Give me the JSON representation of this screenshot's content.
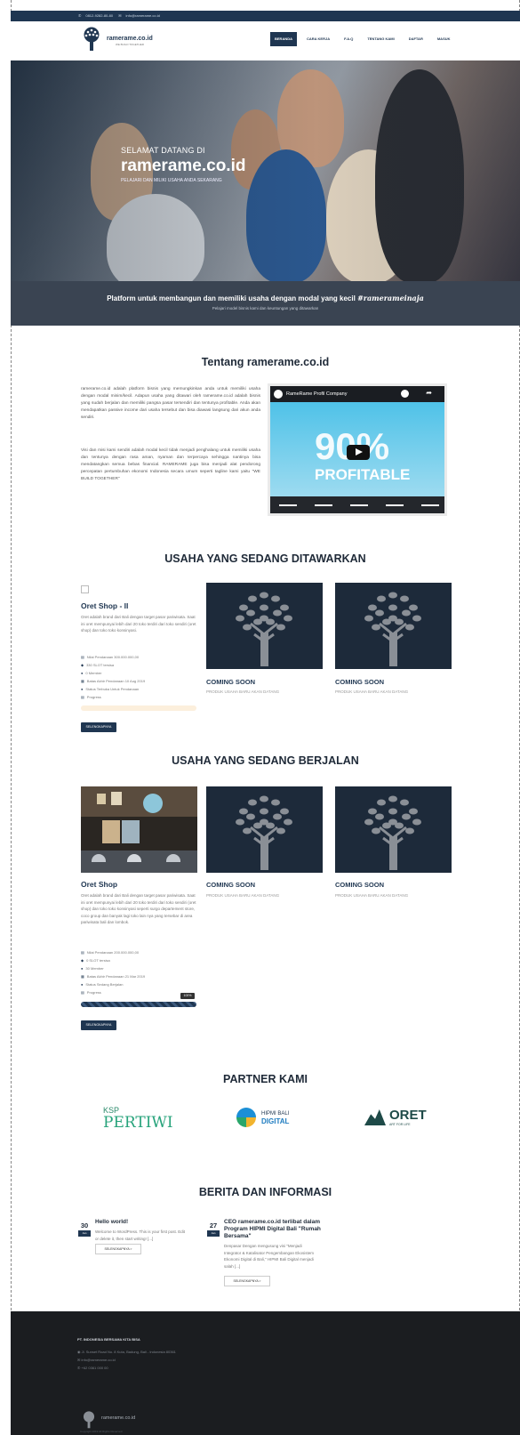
{
  "topbar": {
    "phone": "0812-9282-80-80",
    "email": "info@ramerame.co.id"
  },
  "brand": {
    "name": "ramerame.co.id",
    "tagline": "WE BUILD TOGETHER"
  },
  "nav": [
    "BERANDA",
    "CARA KERJA",
    "F.A.Q",
    "TENTANG KAMI",
    "DAFTAR",
    "MASUK"
  ],
  "hero": {
    "welcome": "SELAMAT DATANG DI",
    "title": "ramerame.co.id",
    "subtitle": "PELAJARI DAN MILIKI USAHA ANDA SEKARANG"
  },
  "strip": {
    "main": "Platform untuk membangun dan memiliki usaha dengan modal yang kecil",
    "hashtag": "#ramerameinaja",
    "sub": "Pelajari model bisnis kami dan keuntungan yang ditawarkan"
  },
  "about": {
    "title": "Tentang ramerame.co.id",
    "p1": "ramerame.co.id adalah platform bisnis yang memungkinkan anda untuk memiliki usaha dengan modal minim/kecil. Adapun usaha yang ditawari oleh ramerame.co.id adalah bisnis yang sudah berjalan dan memiliki pangsa pasar tersendiri dan tentunya profitable. Anda akan mendapatkan passive income dari usaha tersebut dan bisa diawasi langsung dari akun anda sendiri.",
    "p2": "Visi dan misi kami sendiri adalah modal kecil tidak menjadi penghalang untuk memiliki usaha dan tentunya dengan rasa aman, nyaman dan terpercaya sehingga nantinya bisa mendatangkan semua bebas financial. RAMERAME juga bisa menjadi alat pendorong percepatan pertumbuhan ekonomi Indonesia secara umum seperti tagline kami yaitu \"WE BUILD TOGETHER\"",
    "video_title": "RameRame Profil Company",
    "video_big": "90%",
    "video_small": "PROFITABLE"
  },
  "offered": {
    "title": "USAHA YANG SEDANG DITAWARKAN",
    "main": {
      "name": "Oret Shop - II",
      "desc": "Oret adalah brand dari Bali dengan target pasar pariwisata. Saat ini oret mempunyai lebih dari 20 toko terdiri dari toko sendiri (oret shop) dan toko toko konsinyasi.",
      "meta": [
        "Nilai Pendanaan 300.000.000,00",
        "330 SLOT tersisa",
        "0 Member",
        "Batas Akhir Pendanaan 10 Aug 2019",
        "Status Terbuka Untuk Pendanaan",
        "Progress"
      ],
      "progress": 0,
      "button": "SELENGKAPNYA"
    },
    "cards": [
      {
        "title": "COMING SOON",
        "sub": "PRODUK USAHA BARU AKAN DATANG"
      },
      {
        "title": "COMING SOON",
        "sub": "PRODUK USAHA BARU AKAN DATANG"
      }
    ]
  },
  "running": {
    "title": "USAHA YANG SEDANG BERJALAN",
    "main": {
      "name": "Oret Shop",
      "desc": "Oret adalah brand dari Bali dengan target pasar pariwisata. Saat ini oret mempunyai lebih dari 20 toko terdiri dari toko sendiri (oret shop) dan toko toko konsinyasi seperti surgo departement store, coco group dan banyak lagi toko lain nya yang tersebar di area pariwisata bali dan lombok.",
      "meta": [
        "Nilai Pendanaan 200.000.000,00",
        "0 SLOT tersisa",
        "30 Member",
        "Batas Akhir Pendanaan 21 Mar 2019",
        "Status Sedang Berjalan",
        "Progress"
      ],
      "progress": 1,
      "progress_label": "100%",
      "button": "SELENGKAPNYA"
    },
    "cards": [
      {
        "title": "COMING SOON",
        "sub": "PRODUK USAHA BARU AKAN DATANG"
      },
      {
        "title": "COMING SOON",
        "sub": "PRODUK USAHA BARU AKAN DATANG"
      }
    ]
  },
  "partners": {
    "title": "PARTNER KAMI",
    "items": [
      {
        "top": "KSP",
        "main": "PERTIWI"
      },
      {
        "top": "HIPMI BALI",
        "main": "DIGITAL"
      },
      {
        "top": "ORET",
        "main": "ART FOR LIFE"
      }
    ]
  },
  "news": {
    "title": "BERITA DAN INFORMASI",
    "items": [
      {
        "day": "30",
        "month": "Jan",
        "title": "Hello world!",
        "text": "Welcome to WordPress. This is your first post. Edit or delete it, then start writing! [...]",
        "button": "SELENGKAPNYA  >"
      },
      {
        "day": "27",
        "month": "Jan",
        "title": "CEO ramerame.co.id terlibat dalam Program HIPMI Digital Bali \"Rumah Bersama\"",
        "text": "Denpasar Dengan mengusung visi \"Menjadi Integrator & Katalisator Pengembangan Ekosistem Ekonomi Digital di Bali,\" HIPMI Bali Digital menjadi salah [...]",
        "button": "SELENGKAPNYA  >"
      }
    ]
  },
  "footer": {
    "company": "PT. INDONESIA BERSAMA KITA BISA",
    "address": "Jl. Sunset Road No. 8 Kuta, Badung, Bali - Indonesia 80361",
    "email": "info@ramerame.co.id",
    "phone": "+62 0361 000 00",
    "brand": "ramerame.co.id",
    "copyright": "Copyright 2019 All Rights Reserved"
  },
  "colors": {
    "primary": "#1f3651",
    "strip": "#3a4452",
    "footer": "#1b1d20"
  }
}
